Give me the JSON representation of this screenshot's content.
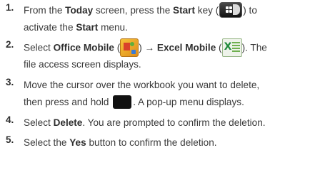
{
  "steps": [
    {
      "number": "1.",
      "t1": "From the ",
      "b1": "Today",
      "t2": " screen, press the ",
      "b2": "Start",
      "t3": " key (",
      "t4": ") to",
      "line2_t1": "activate the ",
      "line2_b1": "Start",
      "line2_t2": " menu."
    },
    {
      "number": "2.",
      "t1": "Select ",
      "b1": "Office Mobile",
      "t2": " (",
      "t3": ") ",
      "arrow": "→",
      "b2": " Excel Mobile",
      "t4": " (",
      "t5": "). The",
      "line2": "file access screen displays."
    },
    {
      "number": "3.",
      "line1": "Move the cursor over the workbook you want to delete,",
      "line2_t1": "then press and hold ",
      "line2_t2": ". A pop-up menu displays."
    },
    {
      "number": "4.",
      "t1": "Select ",
      "b1": "Delete",
      "t2": ". You are prompted to confirm the deletion."
    },
    {
      "number": "5.",
      "t1": "Select the ",
      "b1": "Yes",
      "t2": " button to confirm the deletion."
    }
  ],
  "icons": {
    "start_key": "windows-start-key-icon",
    "office_mobile": "office-mobile-icon",
    "excel_mobile": "excel-mobile-icon",
    "action_key": "action-key-icon"
  }
}
